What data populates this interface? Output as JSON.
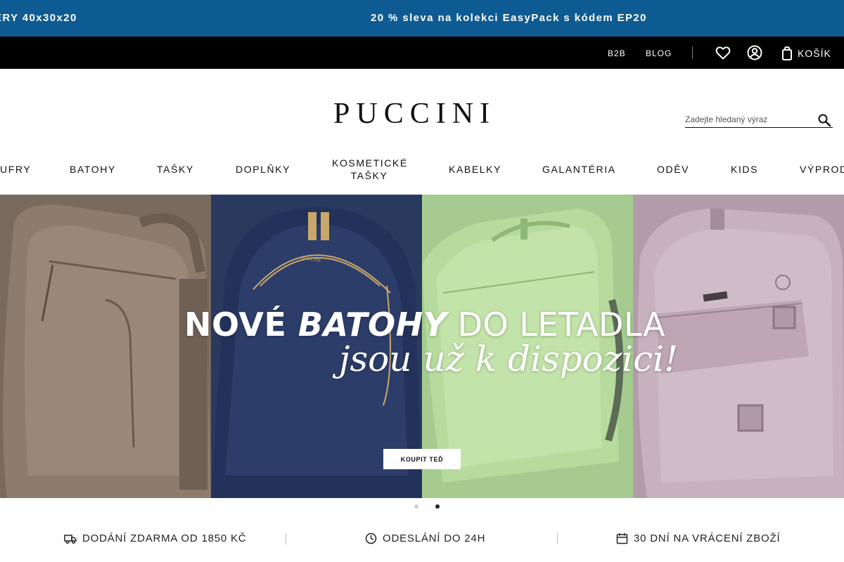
{
  "promo": {
    "left_text": "ĚRY 40x30x20",
    "center_text": "20 % sleva na kolekci EasyPack s kódem EP20"
  },
  "topbar": {
    "b2b": "B2B",
    "blog": "BLOG",
    "cart_label": "KOŠÍK",
    "icons": [
      "heart-icon",
      "user-icon",
      "bag-icon"
    ]
  },
  "header": {
    "logo": "PUCCINI",
    "search_placeholder": "Zadejte hledaný výraz"
  },
  "nav": {
    "items": [
      "UFRY",
      "BATOHY",
      "TAŠKY",
      "DOPLŇKY",
      "KOSMETICKÉ",
      "TAŠKY",
      "KABELKY",
      "GALANTÉRIA",
      "ODĚV",
      "KIDS",
      "VÝPROD"
    ]
  },
  "hero": {
    "title_part1": "NOVÉ ",
    "title_part2": "BATOHY",
    "title_part3": " DO LETADLA",
    "subtitle": "jsou už k dispozici!",
    "button": "KOUPIT TEĎ",
    "bag_label": "PUCCINI",
    "slide_count": 2,
    "active_slide": 2
  },
  "benefits": [
    {
      "icon": "truck-icon",
      "text": "DODÁNÍ ZDARMA OD 1850 KČ"
    },
    {
      "icon": "clock-icon",
      "text": "ODESLÁNÍ DO 24H"
    },
    {
      "icon": "calendar-icon",
      "text": "30 DNÍ NA VRÁCENÍ ZBOŽÍ"
    }
  ],
  "colors": {
    "promo_bg": "#0e5a92",
    "topbar_bg": "#000000",
    "panel_brown": "#7d6c60",
    "panel_navy": "#1f2f52",
    "panel_green": "#a9cf93",
    "panel_lilac": "#b59daa"
  }
}
